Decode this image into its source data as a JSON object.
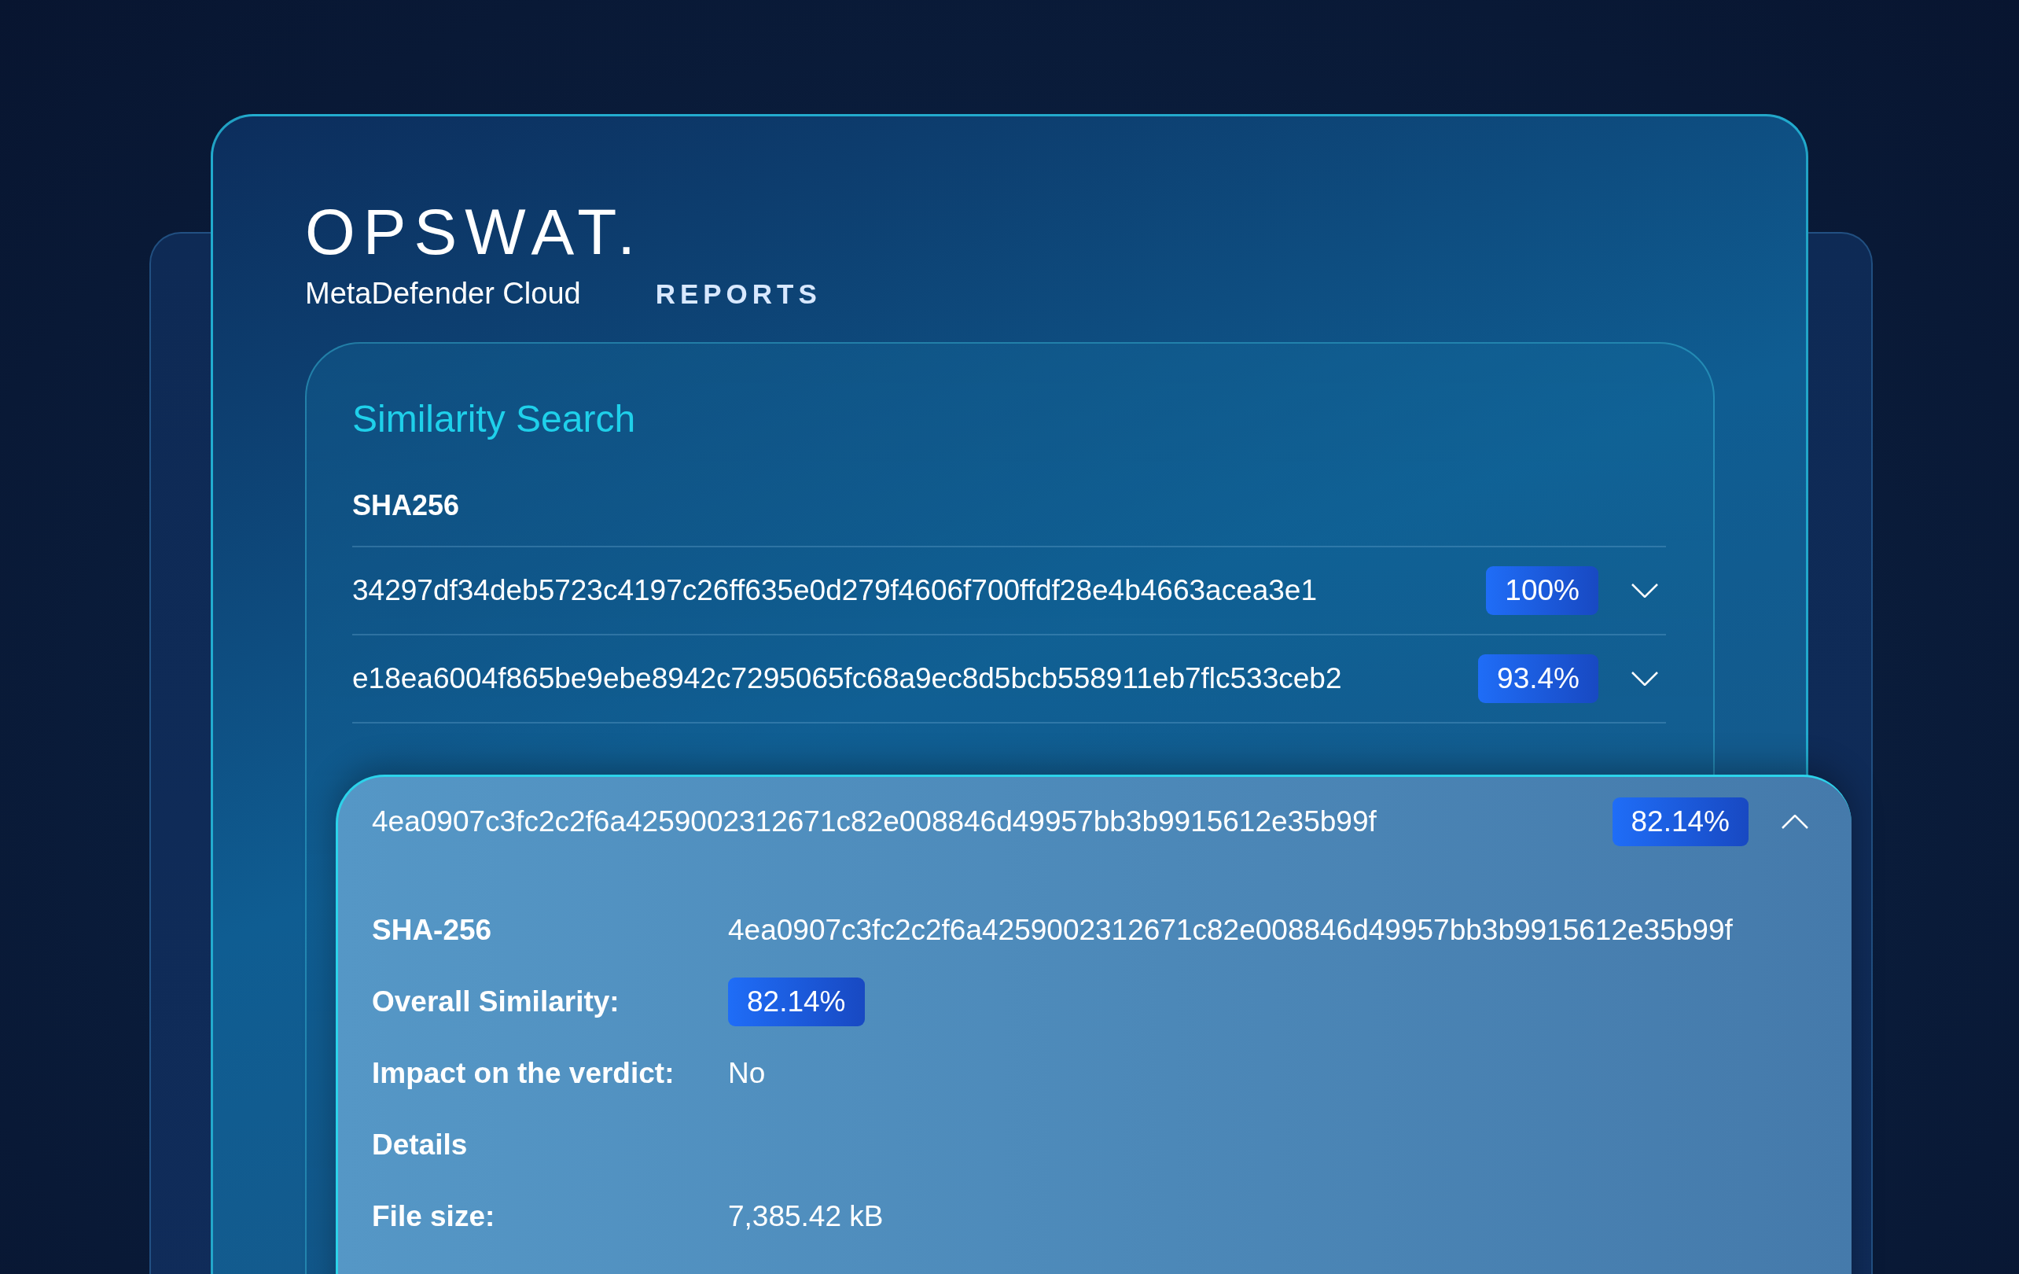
{
  "brand": {
    "logo": "OPSWAT.",
    "product": "MetaDefender Cloud",
    "section": "REPORTS"
  },
  "panel": {
    "title": "Similarity Search",
    "column_header": "SHA256",
    "rows": [
      {
        "hash": "34297df34deb5723c4197c26ff635e0d279f4606f700ffdf28e4b4663acea3e1",
        "similarity": "100%",
        "expanded": false
      },
      {
        "hash": "e18ea6004f865be9ebe8942c7295065fc68a9ec8d5bcb558911eb7flc533ceb2",
        "similarity": "93.4%",
        "expanded": false
      }
    ]
  },
  "detail": {
    "hash": "4ea0907c3fc2c2f6a4259002312671c82e008846d49957bb3b9915612e35b99f",
    "similarity": "82.14%",
    "expanded": true,
    "fields": [
      {
        "kind": "text",
        "label": "SHA-256",
        "value": "4ea0907c3fc2c2f6a4259002312671c82e008846d49957bb3b9915612e35b99f"
      },
      {
        "kind": "badge",
        "label": "Overall Similarity:",
        "value": "82.14%"
      },
      {
        "kind": "text",
        "label": "Impact on the verdict:",
        "value": "No"
      },
      {
        "kind": "heading",
        "label": "Details"
      },
      {
        "kind": "text",
        "label": "File size:",
        "value": "7,385.42 kB"
      }
    ]
  }
}
